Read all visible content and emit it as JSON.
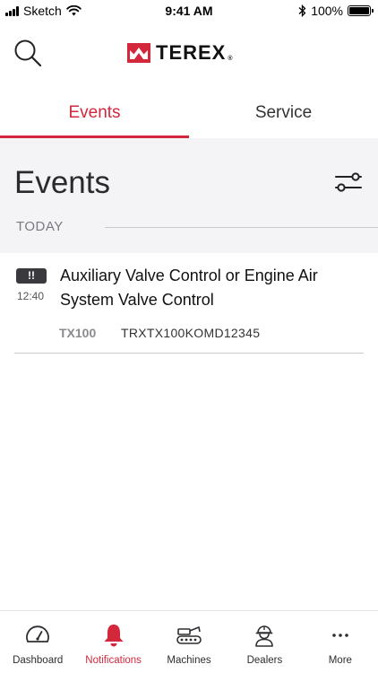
{
  "status_bar": {
    "carrier": "Sketch",
    "time": "9:41 AM",
    "battery": "100%"
  },
  "header": {
    "logo_text": "TEREX",
    "logo_reg": "®",
    "icons": {
      "search": "search-icon",
      "logo": "terex-logo-mark"
    }
  },
  "tabs": [
    {
      "label": "Events",
      "active": true
    },
    {
      "label": "Service",
      "active": false
    }
  ],
  "events": {
    "title": "Events",
    "filter_icon": "filter-sliders-icon",
    "group_label": "TODAY",
    "items": [
      {
        "badge": "!!",
        "time": "12:40",
        "title": "Auxiliary Valve Control or Engine Air System Valve Control",
        "model": "TX100",
        "serial": "TRXTX100KOMD12345"
      }
    ]
  },
  "bottom_nav": [
    {
      "label": "Dashboard",
      "icon": "gauge-icon",
      "active": false
    },
    {
      "label": "Notifications",
      "icon": "bell-icon",
      "active": true
    },
    {
      "label": "Machines",
      "icon": "crawler-machine-icon",
      "active": false
    },
    {
      "label": "Dealers",
      "icon": "worker-helmet-icon",
      "active": false
    },
    {
      "label": "More",
      "icon": "more-dots-icon",
      "active": false
    }
  ],
  "colors": {
    "accent": "#d3283c",
    "section_bg": "#f4f4f6",
    "badge_bg": "#3a3a3e"
  }
}
